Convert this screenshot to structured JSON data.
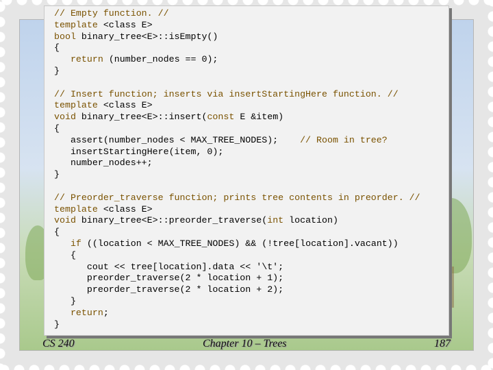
{
  "slide": {
    "code_lines": [
      {
        "segments": [
          {
            "text": "// Empty function. //",
            "color": "#7a5200"
          }
        ]
      },
      {
        "segments": [
          {
            "text": "template ",
            "color": "#7a5200"
          },
          {
            "text": "<class E>",
            "color": "#000000"
          }
        ]
      },
      {
        "segments": [
          {
            "text": "bool ",
            "color": "#7a5200"
          },
          {
            "text": "binary_tree<E>::isEmpty()",
            "color": "#000000"
          }
        ]
      },
      {
        "segments": [
          {
            "text": "{",
            "color": "#000000"
          }
        ]
      },
      {
        "segments": [
          {
            "text": "   ",
            "color": "#000000"
          },
          {
            "text": "return ",
            "color": "#7a5200"
          },
          {
            "text": "(number_nodes == 0);",
            "color": "#000000"
          }
        ]
      },
      {
        "segments": [
          {
            "text": "}",
            "color": "#000000"
          }
        ]
      },
      {
        "segments": [
          {
            "text": "",
            "color": "#000000"
          }
        ]
      },
      {
        "segments": [
          {
            "text": "// Insert function; inserts via insertStartingHere function. //",
            "color": "#7a5200"
          }
        ]
      },
      {
        "segments": [
          {
            "text": "template ",
            "color": "#7a5200"
          },
          {
            "text": "<class E>",
            "color": "#000000"
          }
        ]
      },
      {
        "segments": [
          {
            "text": "void ",
            "color": "#7a5200"
          },
          {
            "text": "binary_tree<E>::insert(",
            "color": "#000000"
          },
          {
            "text": "const ",
            "color": "#7a5200"
          },
          {
            "text": "E &item)",
            "color": "#000000"
          }
        ]
      },
      {
        "segments": [
          {
            "text": "{",
            "color": "#000000"
          }
        ]
      },
      {
        "segments": [
          {
            "text": "   assert(number_nodes < MAX_TREE_NODES);    ",
            "color": "#000000"
          },
          {
            "text": "// Room in tree?",
            "color": "#7a5200"
          }
        ]
      },
      {
        "segments": [
          {
            "text": "   insertStartingHere(item, 0);",
            "color": "#000000"
          }
        ]
      },
      {
        "segments": [
          {
            "text": "   number_nodes++;",
            "color": "#000000"
          }
        ]
      },
      {
        "segments": [
          {
            "text": "}",
            "color": "#000000"
          }
        ]
      },
      {
        "segments": [
          {
            "text": "",
            "color": "#000000"
          }
        ]
      },
      {
        "segments": [
          {
            "text": "// Preorder_traverse function; prints tree contents in preorder. //",
            "color": "#7a5200"
          }
        ]
      },
      {
        "segments": [
          {
            "text": "template ",
            "color": "#7a5200"
          },
          {
            "text": "<class E>",
            "color": "#000000"
          }
        ]
      },
      {
        "segments": [
          {
            "text": "void ",
            "color": "#7a5200"
          },
          {
            "text": "binary_tree<E>::preorder_traverse(",
            "color": "#000000"
          },
          {
            "text": "int ",
            "color": "#7a5200"
          },
          {
            "text": "location)",
            "color": "#000000"
          }
        ]
      },
      {
        "segments": [
          {
            "text": "{",
            "color": "#000000"
          }
        ]
      },
      {
        "segments": [
          {
            "text": "   ",
            "color": "#000000"
          },
          {
            "text": "if ",
            "color": "#7a5200"
          },
          {
            "text": "((location < MAX_TREE_NODES) && (!tree[location].vacant))",
            "color": "#000000"
          }
        ]
      },
      {
        "segments": [
          {
            "text": "   {",
            "color": "#000000"
          }
        ]
      },
      {
        "segments": [
          {
            "text": "      cout << tree[location].data << '\\t';",
            "color": "#000000"
          }
        ]
      },
      {
        "segments": [
          {
            "text": "      preorder_traverse(2 * location + 1);",
            "color": "#000000"
          }
        ]
      },
      {
        "segments": [
          {
            "text": "      preorder_traverse(2 * location + 2);",
            "color": "#000000"
          }
        ]
      },
      {
        "segments": [
          {
            "text": "   }",
            "color": "#000000"
          }
        ]
      },
      {
        "segments": [
          {
            "text": "   ",
            "color": "#000000"
          },
          {
            "text": "return",
            "color": "#7a5200"
          },
          {
            "text": ";",
            "color": "#000000"
          }
        ]
      },
      {
        "segments": [
          {
            "text": "}",
            "color": "#000000"
          }
        ]
      }
    ]
  },
  "footer": {
    "course": "CS 240",
    "chapter": "Chapter 10 – Trees",
    "page_number": "187"
  },
  "colors": {
    "keyword": "#7a5200",
    "plain": "#000000",
    "panel_bg": "#f2f2f2"
  }
}
